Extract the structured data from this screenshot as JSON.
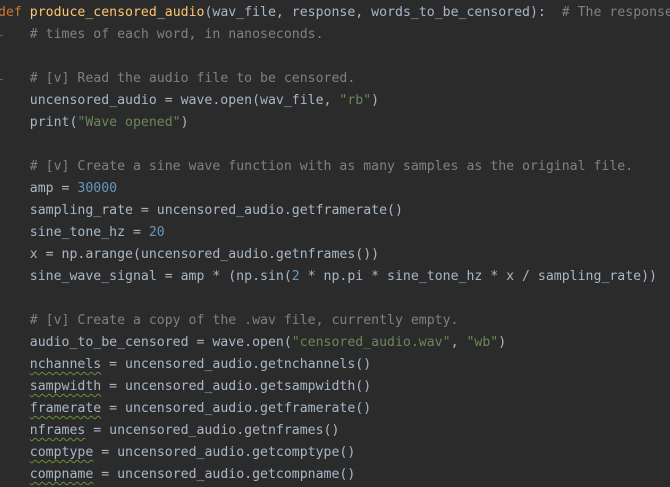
{
  "colors": {
    "background": "#2b2b2b",
    "default": "#a9b7c6",
    "keyword": "#cc7832",
    "function": "#ffc66d",
    "comment": "#808080",
    "string": "#6a8759",
    "number": "#6897bb"
  },
  "lines": [
    [
      {
        "t": "def",
        "c": "kw"
      },
      {
        "t": " "
      },
      {
        "t": "produce_censored_audio",
        "c": "fn"
      },
      {
        "t": "(wav_file, response, words_to_be_censored):  "
      },
      {
        "t": "# The response stores the start and end",
        "c": "cm"
      }
    ],
    [
      {
        "t": "    "
      },
      {
        "t": "# times of each word, in nanoseconds.",
        "c": "cm"
      }
    ],
    [],
    [
      {
        "t": "    "
      },
      {
        "t": "# [v] Read the audio file to be censored.",
        "c": "cm"
      }
    ],
    [
      {
        "t": "    uncensored_audio = wave.open(wav_file, "
      },
      {
        "t": "\"rb\"",
        "c": "st"
      },
      {
        "t": ")"
      }
    ],
    [
      {
        "t": "    print("
      },
      {
        "t": "\"Wave opened\"",
        "c": "st"
      },
      {
        "t": ")"
      }
    ],
    [],
    [
      {
        "t": "    "
      },
      {
        "t": "# [v] Create a sine wave function with as many samples as the original file.",
        "c": "cm"
      }
    ],
    [
      {
        "t": "    amp = "
      },
      {
        "t": "30000",
        "c": "nu"
      }
    ],
    [
      {
        "t": "    sampling_rate = uncensored_audio.getframerate()"
      }
    ],
    [
      {
        "t": "    sine_tone_hz = "
      },
      {
        "t": "20",
        "c": "nu"
      }
    ],
    [
      {
        "t": "    x = np.arange(uncensored_audio.getnframes())"
      }
    ],
    [
      {
        "t": "    sine_wave_signal = amp * (np.sin("
      },
      {
        "t": "2",
        "c": "nu"
      },
      {
        "t": " * np.pi * sine_tone_hz * x / sampling_rate))"
      }
    ],
    [],
    [
      {
        "t": "    "
      },
      {
        "t": "# [v] Create a copy of the .wav file, currently empty.",
        "c": "cm"
      }
    ],
    [
      {
        "t": "    audio_to_be_censored = wave.open("
      },
      {
        "t": "\"censored_audio.wav\"",
        "c": "st"
      },
      {
        "t": ", "
      },
      {
        "t": "\"wb\"",
        "c": "st"
      },
      {
        "t": ")"
      }
    ],
    [
      {
        "t": "    "
      },
      {
        "t": "nchannels",
        "c": "sq"
      },
      {
        "t": " = uncensored_audio.getnchannels()"
      }
    ],
    [
      {
        "t": "    "
      },
      {
        "t": "sampwidth",
        "c": "sq"
      },
      {
        "t": " = uncensored_audio.getsampwidth()"
      }
    ],
    [
      {
        "t": "    "
      },
      {
        "t": "framerate",
        "c": "sq"
      },
      {
        "t": " = uncensored_audio.getframerate()"
      }
    ],
    [
      {
        "t": "    "
      },
      {
        "t": "nframes",
        "c": "sq"
      },
      {
        "t": " = uncensored_audio.getnframes()"
      }
    ],
    [
      {
        "t": "    "
      },
      {
        "t": "comptype",
        "c": "sq"
      },
      {
        "t": " = uncensored_audio.getcomptype()"
      }
    ],
    [
      {
        "t": "    "
      },
      {
        "t": "compname",
        "c": "sq"
      },
      {
        "t": " = uncensored_audio.getcompname()"
      }
    ]
  ]
}
